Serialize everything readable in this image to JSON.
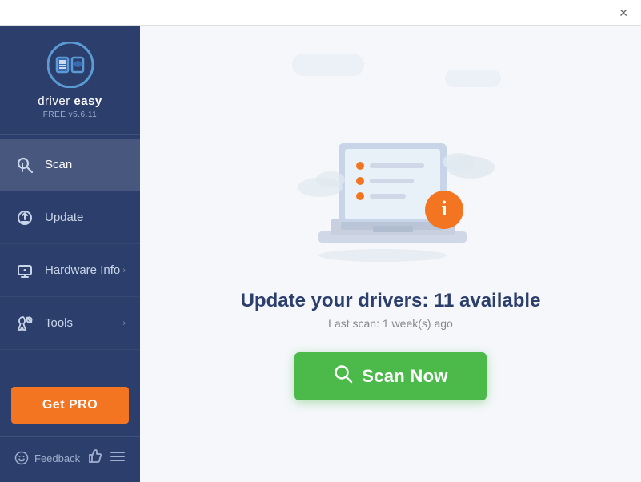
{
  "titlebar": {
    "minimize_label": "—",
    "close_label": "✕"
  },
  "sidebar": {
    "logo_title_part1": "driver",
    "logo_title_part2": "easy",
    "version": "FREE v5.6.11",
    "nav_items": [
      {
        "id": "scan",
        "label": "Scan",
        "icon": "🔍",
        "has_chevron": false,
        "active": true
      },
      {
        "id": "update",
        "label": "Update",
        "icon": "⚙",
        "has_chevron": false,
        "active": false
      },
      {
        "id": "hardware-info",
        "label": "Hardware Info",
        "icon": "💻",
        "has_chevron": true,
        "active": false
      },
      {
        "id": "tools",
        "label": "Tools",
        "icon": "🔧",
        "has_chevron": true,
        "active": false
      }
    ],
    "get_pro_label": "Get PRO",
    "feedback_label": "Feedback"
  },
  "main": {
    "update_title": "Update your drivers: 11 available",
    "last_scan_text": "Last scan: 1 week(s) ago",
    "scan_now_label": "Scan Now"
  }
}
